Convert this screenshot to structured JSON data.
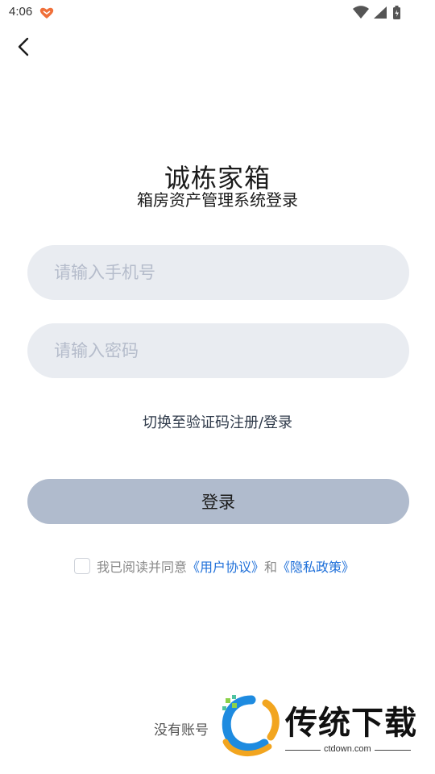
{
  "status_bar": {
    "time": "4:06"
  },
  "header": {
    "title": "诚栋家箱",
    "subtitle": "箱房资产管理系统登录"
  },
  "form": {
    "phone_placeholder": "请输入手机号",
    "password_placeholder": "请输入密码",
    "switch_link": "切换至验证码注册/登录",
    "login_button": "登录"
  },
  "agreement": {
    "checked": false,
    "prefix": "我已阅读并同意",
    "user_agreement": "《用户协议》",
    "conjunction": "和",
    "privacy_policy": "《隐私政策》"
  },
  "footer": {
    "no_account": "没有账号"
  },
  "watermark": {
    "title": "传统下载",
    "url": "ctdown.com"
  },
  "colors": {
    "input_bg": "#e9ecf1",
    "button_bg": "#b0bbcd",
    "link": "#1e6fd9"
  }
}
